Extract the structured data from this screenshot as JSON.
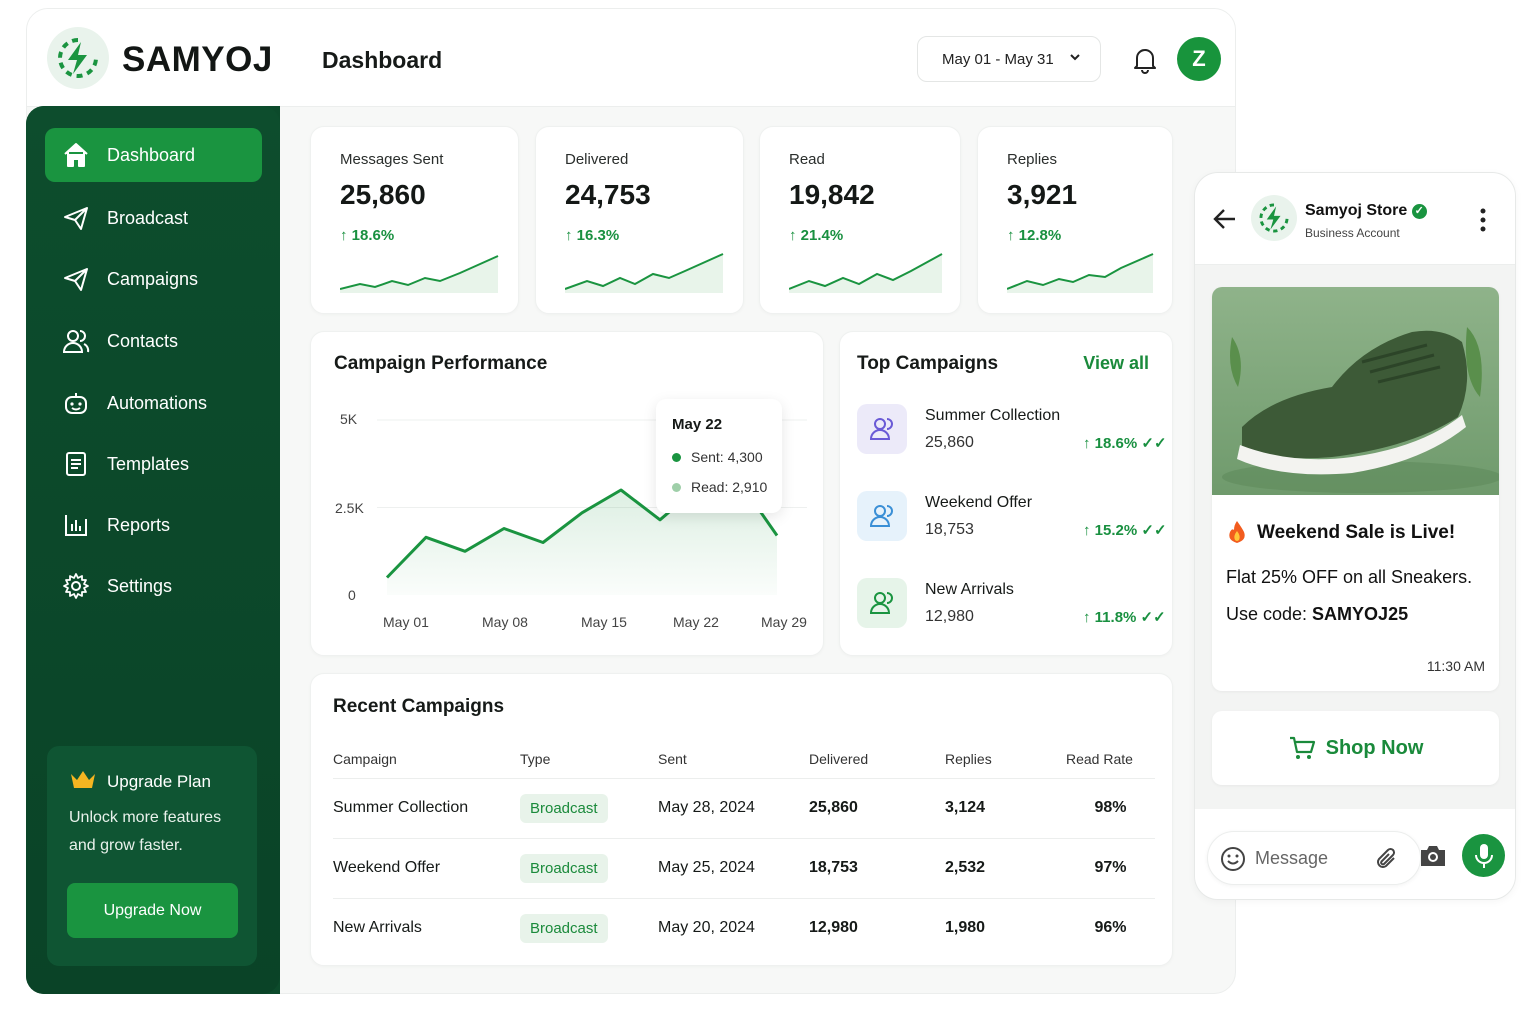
{
  "brand": {
    "name": "SAMYOJ"
  },
  "header": {
    "title": "Dashboard",
    "date_range": "May 01 - May 31",
    "avatar_initial": "Z"
  },
  "sidebar": {
    "items": [
      {
        "label": "Dashboard",
        "icon": "home-icon",
        "active": true
      },
      {
        "label": "Broadcast",
        "icon": "send-icon"
      },
      {
        "label": "Campaigns",
        "icon": "send-icon"
      },
      {
        "label": "Contacts",
        "icon": "users-icon"
      },
      {
        "label": "Automations",
        "icon": "robot-icon"
      },
      {
        "label": "Templates",
        "icon": "document-icon"
      },
      {
        "label": "Reports",
        "icon": "bar-chart-icon"
      },
      {
        "label": "Settings",
        "icon": "gear-icon"
      }
    ],
    "upgrade": {
      "title": "Upgrade Plan",
      "description": "Unlock more features and grow faster.",
      "button": "Upgrade Now"
    }
  },
  "stats": [
    {
      "label": "Messages Sent",
      "value": "25,860",
      "trend": "↑ 18.6%"
    },
    {
      "label": "Delivered",
      "value": "24,753",
      "trend": "↑ 16.3%"
    },
    {
      "label": "Read",
      "value": "19,842",
      "trend": "↑ 21.4%"
    },
    {
      "label": "Replies",
      "value": "3,921",
      "trend": "↑ 12.8%"
    }
  ],
  "performance": {
    "title": "Campaign Performance",
    "chart_data": {
      "type": "area",
      "title": "Campaign Performance",
      "x_ticks": [
        "May 01",
        "May 08",
        "May 15",
        "May 22",
        "May 29"
      ],
      "y_ticks": [
        "5K",
        "2.5K",
        "0"
      ],
      "ylim": [
        0,
        5000
      ],
      "series": [
        {
          "name": "Sent",
          "x": [
            "May 01",
            "May 04",
            "May 07",
            "May 10",
            "May 13",
            "May 16",
            "May 19",
            "May 22",
            "May 25",
            "May 28",
            "May 31"
          ],
          "values": [
            500,
            1650,
            1250,
            1900,
            1500,
            2350,
            3000,
            2150,
            3100,
            3300,
            1700
          ]
        }
      ],
      "tooltip": {
        "date": "May 22",
        "sent": "Sent: 4,300",
        "read": "Read: 2,910"
      },
      "grid": true
    }
  },
  "top_campaigns": {
    "title": "Top Campaigns",
    "view_all": "View all",
    "items": [
      {
        "name": "Summer Collection",
        "count": "25,860",
        "pct": "↑ 18.6%"
      },
      {
        "name": "Weekend Offer",
        "count": "18,753",
        "pct": "↑ 15.2%"
      },
      {
        "name": "New Arrivals",
        "count": "12,980",
        "pct": "↑ 11.8%"
      }
    ]
  },
  "recent": {
    "title": "Recent Campaigns",
    "columns": [
      "Campaign",
      "Type",
      "Sent",
      "Delivered",
      "Replies",
      "Read Rate"
    ],
    "rows": [
      [
        "Summer Collection",
        "Broadcast",
        "May 28, 2024",
        "25,860",
        "3,124",
        "98%"
      ],
      [
        "Weekend Offer",
        "Broadcast",
        "May 25, 2024",
        "18,753",
        "2,532",
        "97%"
      ],
      [
        "New Arrivals",
        "Broadcast",
        "May 20, 2024",
        "12,980",
        "1,980",
        "96%"
      ]
    ]
  },
  "phone": {
    "store_name": "Samyoj Store",
    "store_sub": "Business Account",
    "message": {
      "title": "Weekend Sale is Live!",
      "line1": "Flat 25% OFF on all Sneakers.",
      "code_prefix": "Use code: ",
      "code": "SAMYOJ25",
      "time": "11:30 AM"
    },
    "shop_button": "Shop Now",
    "input_placeholder": "Message"
  },
  "colors": {
    "primary": "#1a9440",
    "sidebar": "#0c4a2b",
    "accent_text": "#199040"
  }
}
